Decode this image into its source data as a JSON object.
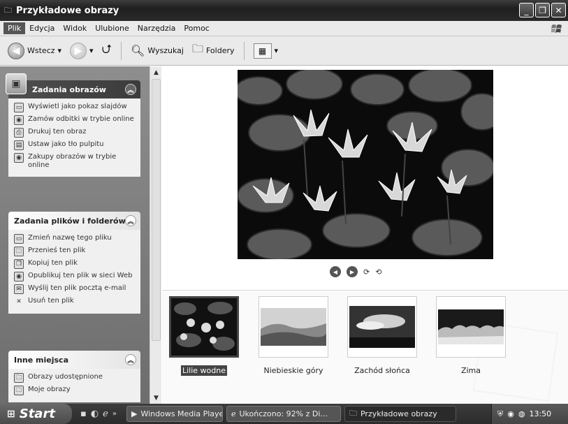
{
  "window": {
    "title": "Przykładowe obrazy"
  },
  "menu": [
    "Plik",
    "Edycja",
    "Widok",
    "Ulubione",
    "Narzędzia",
    "Pomoc"
  ],
  "toolbar": {
    "back_label": "Wstecz",
    "search_label": "Wyszukaj",
    "folders_label": "Foldery"
  },
  "panels": {
    "image_tasks": {
      "title": "Zadania obrazów",
      "items": [
        "Wyświetl jako pokaz slajdów",
        "Zamów odbitki w trybie online",
        "Drukuj ten obraz",
        "Ustaw jako tło pulpitu",
        "Zakupy obrazów w trybie online"
      ]
    },
    "file_tasks": {
      "title": "Zadania plików i folderów",
      "items": [
        "Zmień nazwę tego pliku",
        "Przenieś ten plik",
        "Kopiuj ten plik",
        "Opublikuj ten plik w sieci Web",
        "Wyślij ten plik pocztą e-mail",
        "Usuń ten plik"
      ]
    },
    "other_places": {
      "title": "Inne miejsca",
      "items": [
        "Obrazy udostępnione",
        "Moje obrazy"
      ]
    }
  },
  "thumbnails": [
    {
      "label": "Lilie wodne",
      "selected": true
    },
    {
      "label": "Niebieskie góry",
      "selected": false
    },
    {
      "label": "Zachód słońca",
      "selected": false
    },
    {
      "label": "Zima",
      "selected": false
    }
  ],
  "taskbar": {
    "start_label": "Start",
    "tasks": [
      "Windows Media Player",
      "Ukończono: 92% z Di...",
      "Przykładowe obrazy"
    ],
    "clock": "13:50"
  }
}
